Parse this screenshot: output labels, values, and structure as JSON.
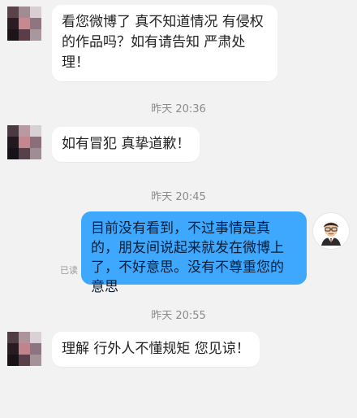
{
  "messages": [
    {
      "side": "left",
      "text": "看您微博了 真不知道情况 有侵权的作品吗？如有请告知 严肃处理！"
    },
    {
      "time": "昨天 20:36"
    },
    {
      "side": "left",
      "text": "如有冒犯 真挚道歉！"
    },
    {
      "time": "昨天 20:45"
    },
    {
      "side": "right",
      "text": "目前没有看到，不过事情是真的，朋友间说起来就发在微博上了，不好意思。没有不尊重您的意思",
      "status": "已读"
    },
    {
      "time": "昨天 20:55"
    },
    {
      "side": "left",
      "text": "理解 行外人不懂规矩 您见谅！"
    }
  ],
  "icons": {
    "left_avatar": "pixelated-avatar-icon",
    "right_avatar": "user-avatar-icon"
  },
  "colors": {
    "background": "#f2f2f2",
    "bubble_left": "#ffffff",
    "bubble_right": "#3ea8ff",
    "timestamp": "#8a8a8a"
  }
}
